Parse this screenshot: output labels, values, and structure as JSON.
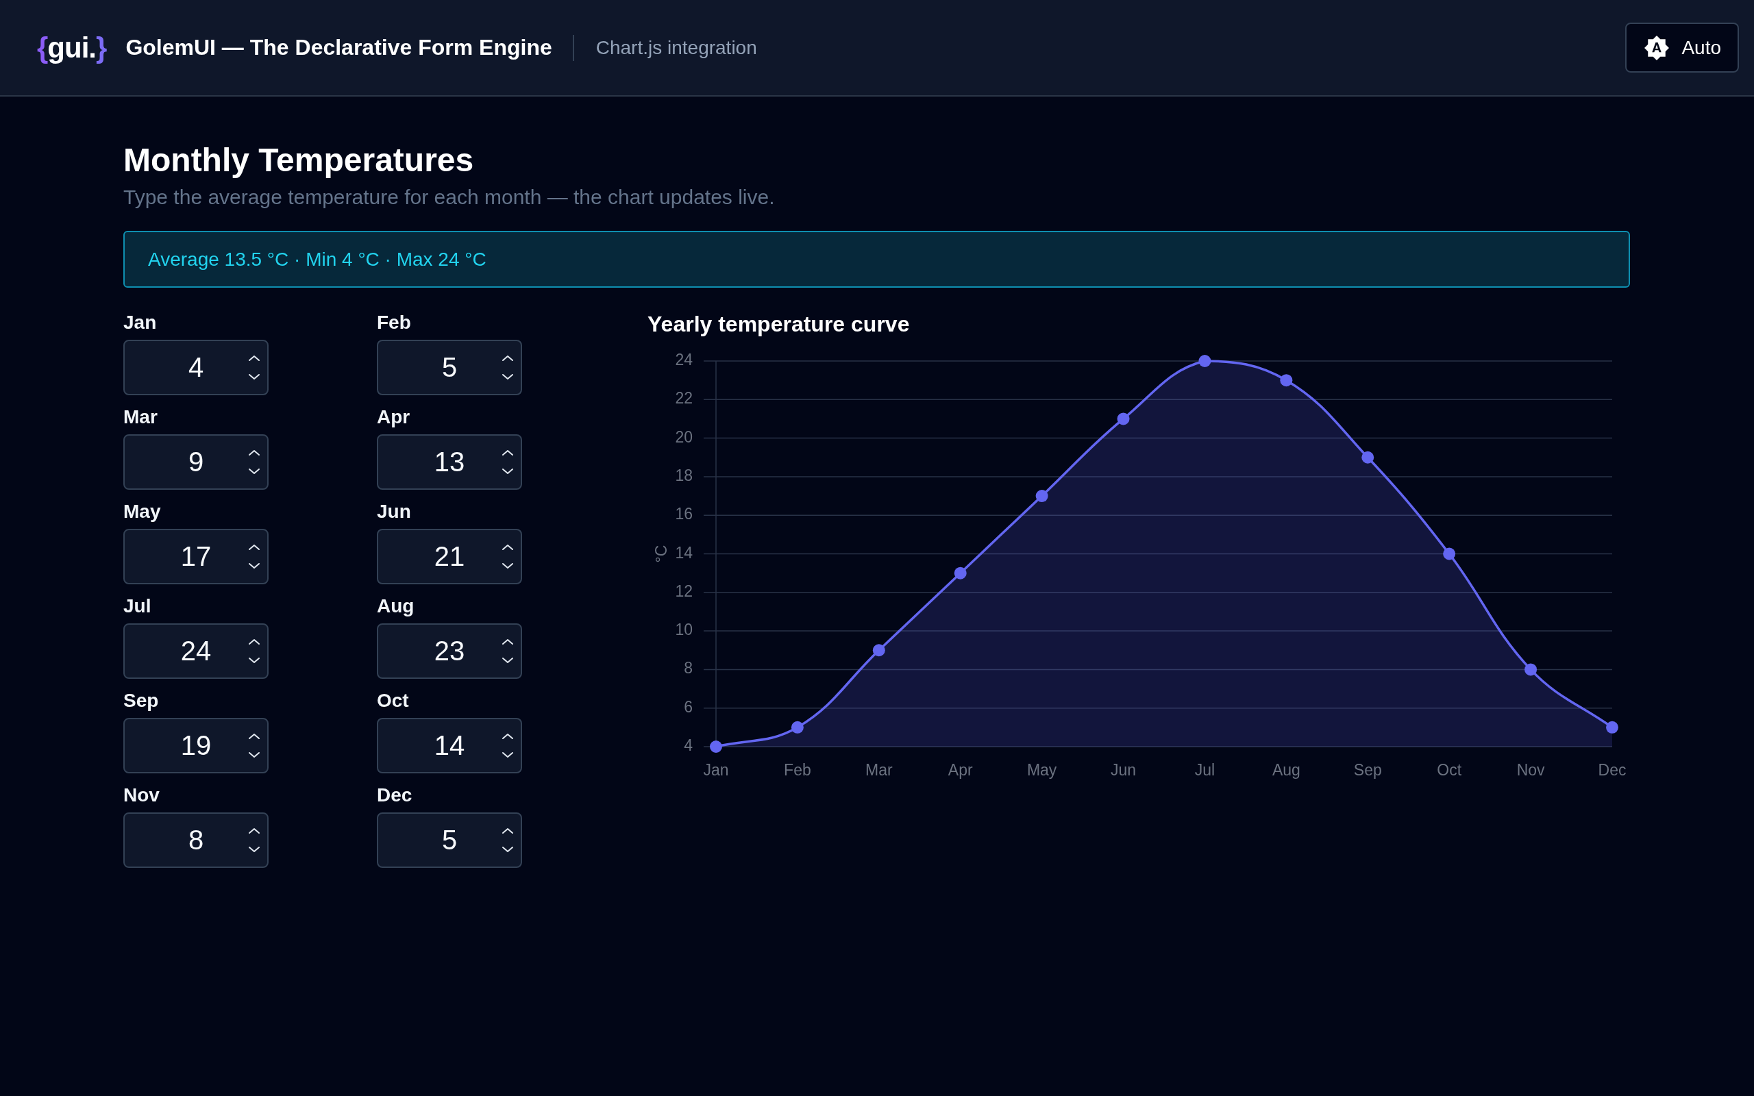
{
  "header": {
    "logo": {
      "brace_open": "{",
      "word": "gui.",
      "brace_close": "}"
    },
    "title": "GolemUI — The Declarative Form Engine",
    "subtitle": "Chart.js integration",
    "theme_button": {
      "label": "Auto"
    }
  },
  "page": {
    "title": "Monthly Temperatures",
    "description": "Type the average temperature for each month — the chart updates live."
  },
  "summary": {
    "text": "Average 13.5 °C · Min 4 °C · Max 24 °C"
  },
  "fields": [
    {
      "label": "Jan",
      "value": "4"
    },
    {
      "label": "Feb",
      "value": "5"
    },
    {
      "label": "Mar",
      "value": "9"
    },
    {
      "label": "Apr",
      "value": "13"
    },
    {
      "label": "May",
      "value": "17"
    },
    {
      "label": "Jun",
      "value": "21"
    },
    {
      "label": "Jul",
      "value": "24"
    },
    {
      "label": "Aug",
      "value": "23"
    },
    {
      "label": "Sep",
      "value": "19"
    },
    {
      "label": "Oct",
      "value": "14"
    },
    {
      "label": "Nov",
      "value": "8"
    },
    {
      "label": "Dec",
      "value": "5"
    }
  ],
  "chart": {
    "chart_data": {
      "type": "area",
      "title": "Yearly temperature curve",
      "ylabel": "°C",
      "categories": [
        "Jan",
        "Feb",
        "Mar",
        "Apr",
        "May",
        "Jun",
        "Jul",
        "Aug",
        "Sep",
        "Oct",
        "Nov",
        "Dec"
      ],
      "series": [
        {
          "color": "#6366f1",
          "values": [
            4,
            5,
            9,
            13,
            17,
            21,
            24,
            23,
            19,
            14,
            8,
            5
          ]
        }
      ],
      "ylim": [
        4,
        24
      ],
      "yticks": [
        4,
        6,
        8,
        10,
        12,
        14,
        16,
        18,
        20,
        22,
        24
      ],
      "grid": true
    }
  }
}
